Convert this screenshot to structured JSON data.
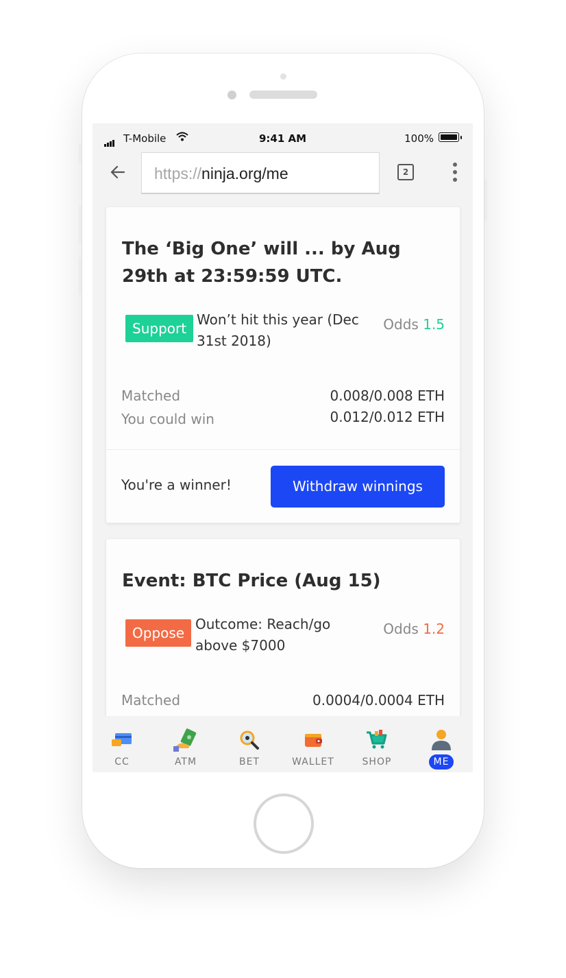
{
  "status_bar": {
    "carrier": "T-Mobile",
    "time": "9:41 AM",
    "battery_percent": "100%"
  },
  "browser": {
    "url_protocol": "https://",
    "url_path": "ninja.org/me",
    "tab_count": "2"
  },
  "cards": [
    {
      "title": "The ‘Big One’ will ... by Aug 29th at 23:59:59 UTC.",
      "side": "Support",
      "side_color": "#1ed196",
      "outcome": "Won’t hit this year (Dec 31st 2018)",
      "odds_label": "Odds",
      "odds_value": "1.5",
      "matched_label": "Matched",
      "matched_value": "0.008/0.008 ETH",
      "win_label": "You could win",
      "win_value": "0.012/0.012 ETH",
      "result_text": "You're a winner!",
      "action_label": "Withdraw winnings"
    },
    {
      "title": "Event: BTC Price (Aug 15)",
      "side": "Oppose",
      "side_color": "#f26b45",
      "outcome": "Outcome: Reach/go above $7000",
      "odds_label": "Odds",
      "odds_value": "1.2",
      "matched_label": "Matched",
      "matched_value": "0.0004/0.0004 ETH"
    }
  ],
  "nav": {
    "items": [
      {
        "label": "CC",
        "icon": "credit-card-icon"
      },
      {
        "label": "ATM",
        "icon": "cash-hand-icon"
      },
      {
        "label": "BET",
        "icon": "magnifier-icon"
      },
      {
        "label": "WALLET",
        "icon": "wallet-icon"
      },
      {
        "label": "SHOP",
        "icon": "cart-icon"
      },
      {
        "label": "ME",
        "icon": "user-icon"
      }
    ],
    "active": "ME"
  },
  "colors": {
    "accent": "#1c47f5",
    "support": "#1ed196",
    "oppose": "#f26b45"
  }
}
